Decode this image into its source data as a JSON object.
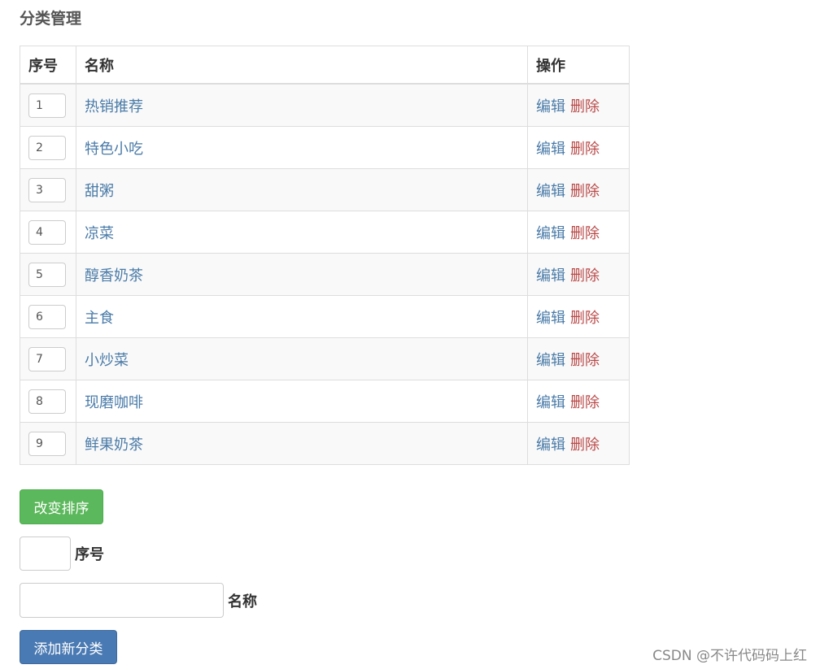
{
  "page": {
    "title": "分类管理"
  },
  "table": {
    "headers": {
      "order": "序号",
      "name": "名称",
      "ops": "操作"
    },
    "rows": [
      {
        "order": "1",
        "name": "热销推荐"
      },
      {
        "order": "2",
        "name": "特色小吃"
      },
      {
        "order": "3",
        "name": "甜粥"
      },
      {
        "order": "4",
        "name": "凉菜"
      },
      {
        "order": "5",
        "name": "醇香奶茶"
      },
      {
        "order": "6",
        "name": "主食"
      },
      {
        "order": "7",
        "name": "小炒菜"
      },
      {
        "order": "8",
        "name": "现磨咖啡"
      },
      {
        "order": "9",
        "name": "鲜果奶茶"
      }
    ],
    "edit_label": "编辑",
    "delete_label": "删除"
  },
  "actions": {
    "sort_button": "改变排序",
    "add_button": "添加新分类"
  },
  "form": {
    "order_label": "序号",
    "order_value": "",
    "name_label": "名称",
    "name_value": ""
  },
  "watermark": "CSDN @不许代码码上红",
  "colors": {
    "link": "#4a7ba8",
    "delete": "#b94a48",
    "success": "#5cb85c",
    "primary": "#4a7ab3"
  }
}
